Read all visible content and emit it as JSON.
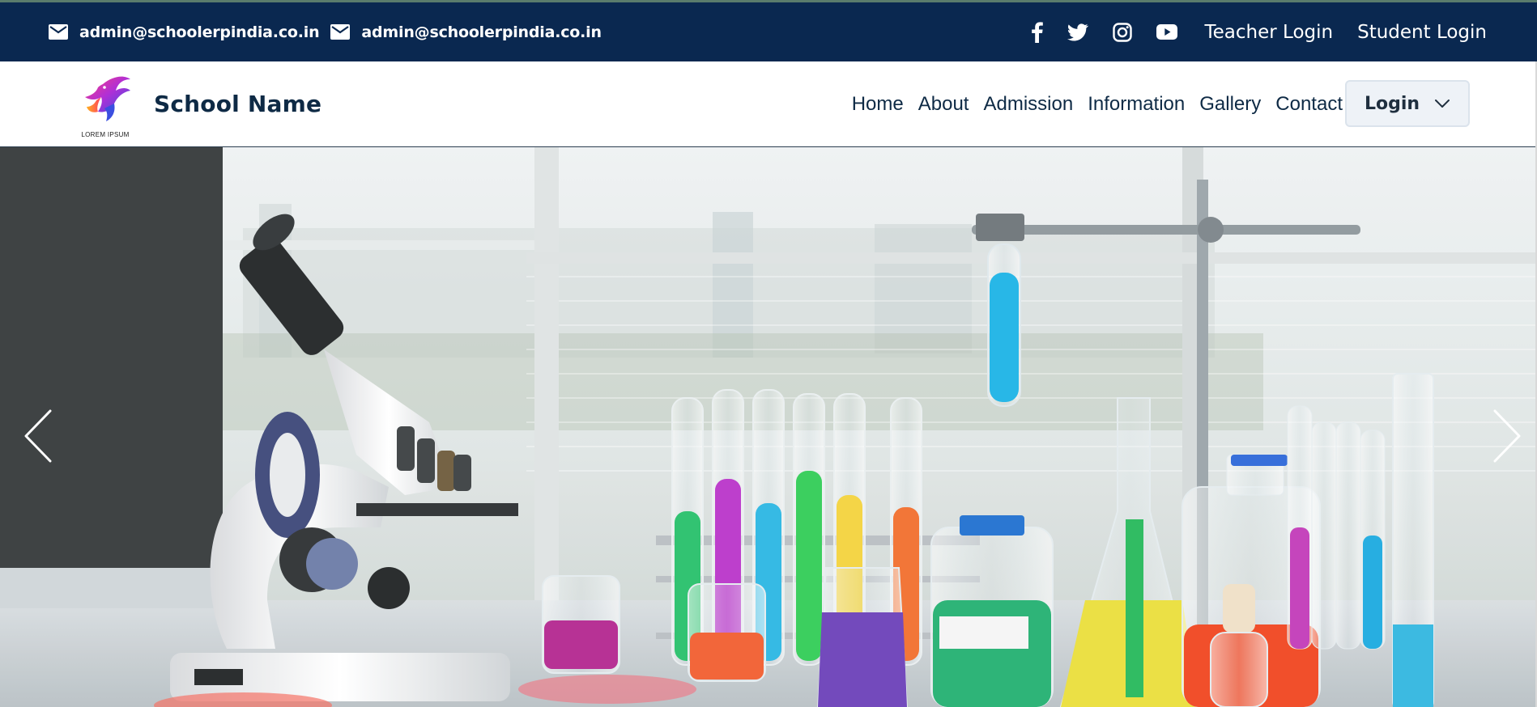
{
  "topbar": {
    "contacts": [
      {
        "icon": "mail-icon",
        "email": "admin@schoolerpindia.co.in"
      },
      {
        "icon": "mail-icon",
        "email": "admin@schoolerpindia.co.in"
      }
    ],
    "social_icons": [
      "facebook-icon",
      "twitter-icon",
      "instagram-icon",
      "youtube-icon"
    ],
    "teacher_login": "Teacher Login",
    "student_login": "Student Login",
    "background_color": "#0a2850"
  },
  "navbar": {
    "logo_text": "LOREM IPSUM",
    "school_name": "School Name",
    "links": [
      "Home",
      "About",
      "Admission",
      "Information",
      "Gallery",
      "Contact"
    ],
    "login_label": "Login"
  },
  "hero": {
    "image": "science-laboratory-photo",
    "prev_icon": "chevron-left-icon",
    "next_icon": "chevron-right-icon"
  }
}
